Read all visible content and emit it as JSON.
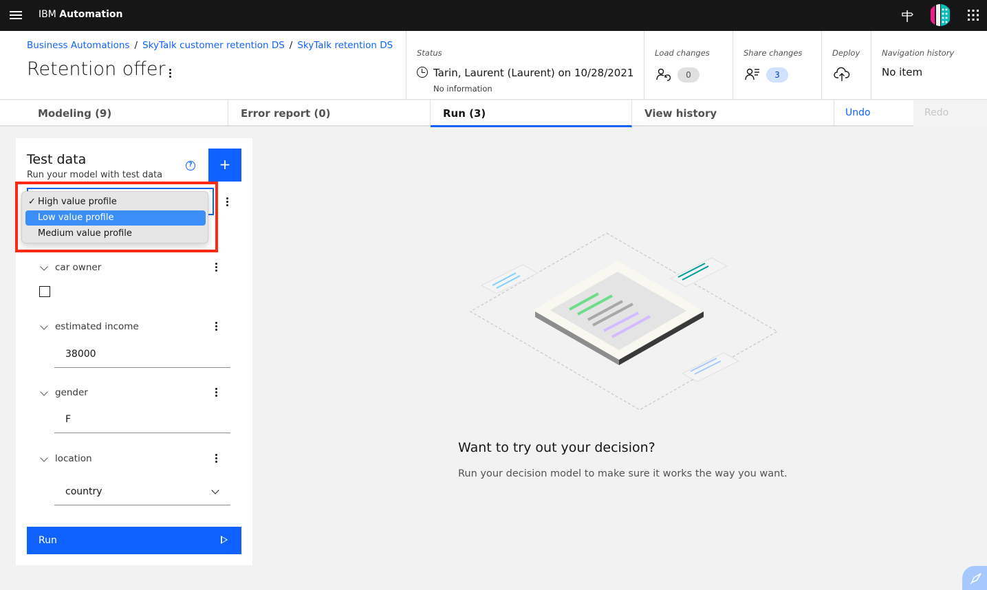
{
  "topbar": {
    "brand_prefix": "IBM",
    "brand_name": "Automation",
    "menu_icon": "hamburger-menu-icon",
    "right_icons": [
      "signpost-icon",
      "avatar",
      "app-switcher-icon"
    ]
  },
  "header": {
    "breadcrumbs": [
      "Business Automations",
      "SkyTalk customer retention DS",
      "SkyTalk retention DS"
    ],
    "breadcrumb_separator": "/",
    "title": "Retention offer",
    "status": {
      "label": "Status",
      "main": "Tarin, Laurent (Laurent) on 10/28/2021",
      "sub": "No information"
    },
    "load_changes": {
      "label": "Load changes",
      "count": "0"
    },
    "share_changes": {
      "label": "Share changes",
      "count": "3"
    },
    "deploy": {
      "label": "Deploy"
    },
    "navigation_history": {
      "label": "Navigation history",
      "value": "No item"
    }
  },
  "tabs": [
    {
      "label": "Modeling (9)",
      "active": false
    },
    {
      "label": "Error report (0)",
      "active": false
    },
    {
      "label": "Run (3)",
      "active": true
    },
    {
      "label": "View history",
      "active": false
    }
  ],
  "actions": {
    "undo": "Undo",
    "redo": "Redo"
  },
  "test_data": {
    "title": "Test data",
    "subtitle": "Run your model with test data",
    "add_button": "+",
    "help_icon": "?",
    "dropdown": {
      "options": [
        {
          "label": "High value profile",
          "checked": true,
          "highlighted": false
        },
        {
          "label": "Low value profile",
          "checked": false,
          "highlighted": true
        },
        {
          "label": "Medium value profile",
          "checked": false,
          "highlighted": false
        }
      ],
      "check_mark": "✓"
    },
    "fields": {
      "car_owner": {
        "label": "car owner",
        "checked": false
      },
      "estimated_income": {
        "label": "estimated income",
        "value": "38000"
      },
      "gender": {
        "label": "gender",
        "value": "F"
      },
      "location": {
        "label": "location",
        "value": "country"
      }
    },
    "run_button": "Run"
  },
  "empty_state": {
    "title": "Want to try out your decision?",
    "subtitle": "Run your decision model to make sure it works the way you want."
  },
  "colors": {
    "accent": "#0f62fe",
    "topbar": "#161616",
    "highlight_box": "#ff2a14",
    "selected_option": "#3b8ef5"
  }
}
